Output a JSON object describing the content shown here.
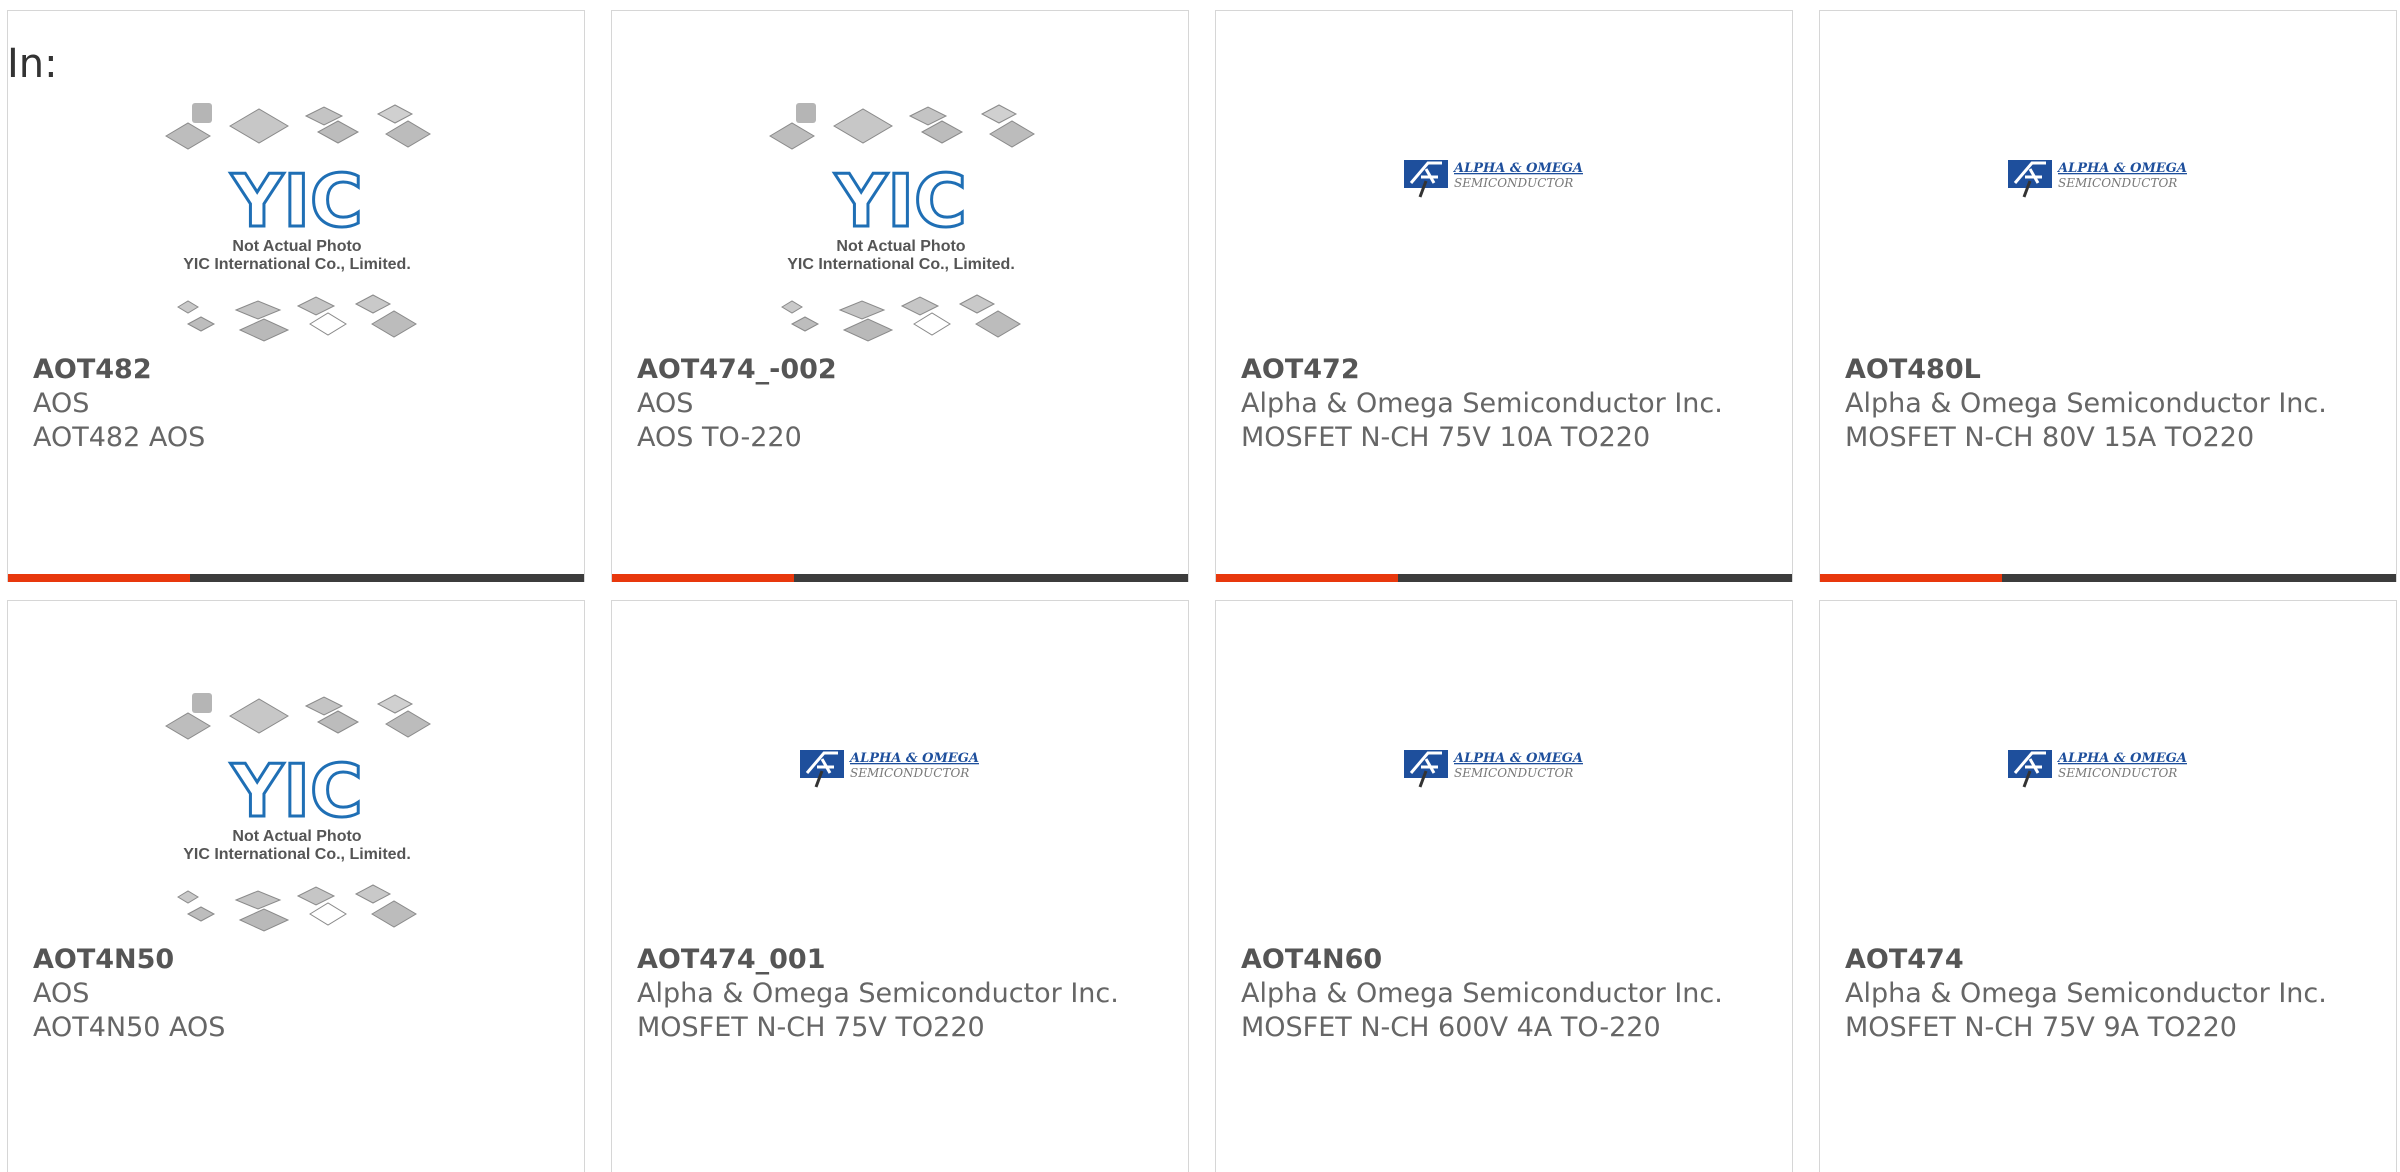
{
  "page": {
    "in_label": "In:"
  },
  "placeholder_image": {
    "logo_text": "YIC",
    "line1": "Not Actual Photo",
    "line2": "YIC International Co., Limited."
  },
  "brand_image": {
    "line1": "ALPHA & OMEGA",
    "line2": "SEMICONDUCTOR"
  },
  "colors": {
    "accent": "#e8380d",
    "bar": "#3c3c3c",
    "border": "#d6d6d6",
    "yic_blue": "#1f6fb5",
    "aos_blue": "#1e4f9c"
  },
  "products": [
    {
      "part": "AOT482",
      "manufacturer": "AOS",
      "description": "AOT482 AOS",
      "image": "placeholder"
    },
    {
      "part": "AOT474_-002",
      "manufacturer": "AOS",
      "description": "AOS TO-220",
      "image": "placeholder"
    },
    {
      "part": "AOT472",
      "manufacturer": "Alpha & Omega Semiconductor Inc.",
      "description": "MOSFET N-CH 75V 10A TO220",
      "image": "aos-logo"
    },
    {
      "part": "AOT480L",
      "manufacturer": "Alpha & Omega Semiconductor Inc.",
      "description": "MOSFET N-CH 80V 15A TO220",
      "image": "aos-logo"
    },
    {
      "part": "AOT4N50",
      "manufacturer": "AOS",
      "description": "AOT4N50 AOS",
      "image": "placeholder"
    },
    {
      "part": "AOT474_001",
      "manufacturer": "Alpha & Omega Semiconductor Inc.",
      "description": "MOSFET N-CH 75V TO220",
      "image": "aos-logo"
    },
    {
      "part": "AOT4N60",
      "manufacturer": "Alpha & Omega Semiconductor Inc.",
      "description": "MOSFET N-CH 600V 4A TO-220",
      "image": "aos-logo"
    },
    {
      "part": "AOT474",
      "manufacturer": "Alpha & Omega Semiconductor Inc.",
      "description": "MOSFET N-CH 75V 9A TO220",
      "image": "aos-logo"
    }
  ]
}
